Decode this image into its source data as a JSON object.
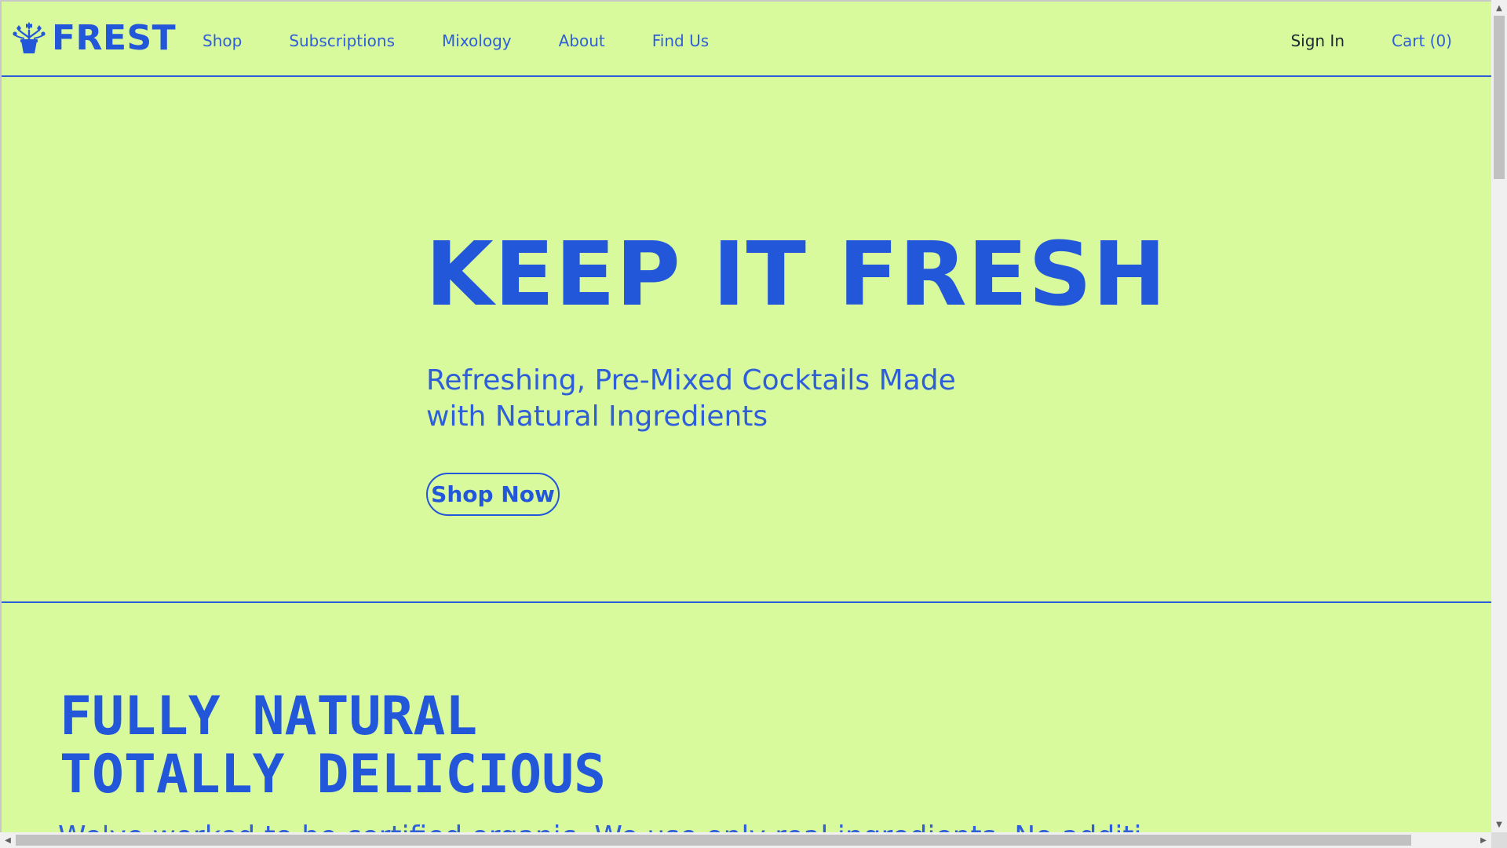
{
  "brand": {
    "name": "FREST",
    "logo_icon": "flower-pot-icon",
    "color": "#2357d9"
  },
  "nav": {
    "items": [
      {
        "label": "Shop"
      },
      {
        "label": "Subscriptions"
      },
      {
        "label": "Mixology"
      },
      {
        "label": "About"
      },
      {
        "label": "Find Us"
      }
    ],
    "sign_in": "Sign In",
    "cart": "Cart (0)"
  },
  "hero": {
    "title": "KEEP IT FRESH",
    "subtitle": "Refreshing, Pre-Mixed Cocktails Made with Natural Ingredients",
    "cta": "Shop Now"
  },
  "section": {
    "title_line1": "FULLY NATURAL",
    "title_line2": "TOTALLY DELICIOUS",
    "body": "We've worked to be certified organic. We use only real ingredients. No additi"
  },
  "colors": {
    "background": "#d9f99d",
    "accent": "#2357d9"
  },
  "scrollbars": {
    "vertical_icons": [
      "up-arrow-icon",
      "down-arrow-icon"
    ],
    "horizontal_icons": [
      "left-arrow-icon",
      "right-arrow-icon"
    ]
  }
}
